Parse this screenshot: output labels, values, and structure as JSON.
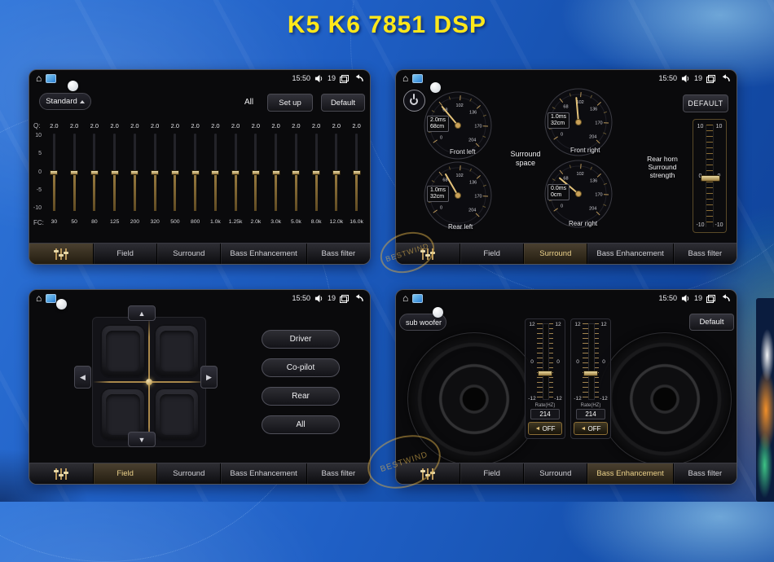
{
  "page": {
    "title": "K5 K6 7851 DSP"
  },
  "statusbar": {
    "time": "15:50",
    "volume_count": "19"
  },
  "tabs": {
    "field": "Field",
    "surround": "Surround",
    "bass_enhancement": "Bass Enhancement",
    "bass_filter": "Bass filter"
  },
  "eq": {
    "preset": "Standard",
    "all_label": "All",
    "setup_label": "Set up",
    "default_label": "Default",
    "q_label": "Q:",
    "fc_label": "FC:",
    "q_values": [
      "2.0",
      "2.0",
      "2.0",
      "2.0",
      "2.0",
      "2.0",
      "2.0",
      "2.0",
      "2.0",
      "2.0",
      "2.0",
      "2.0",
      "2.0",
      "2.0",
      "2.0",
      "2.0"
    ],
    "fc_values": [
      "30",
      "50",
      "80",
      "125",
      "200",
      "320",
      "500",
      "800",
      "1.0k",
      "1.25k",
      "2.0k",
      "3.0k",
      "5.0k",
      "8.0k",
      "12.0k",
      "16.0k"
    ],
    "axis_ticks": [
      "10",
      "5",
      "0",
      "-5",
      "-10"
    ],
    "band_levels_db": [
      0,
      0,
      0,
      0,
      0,
      0,
      0,
      0,
      0,
      0,
      0,
      0,
      0,
      0,
      0,
      0
    ]
  },
  "surround": {
    "default_label": "DEFAULT",
    "center_label": "Surround space",
    "strength_label": "Rear horn Surround strength",
    "strength_ticks": [
      "10",
      "0",
      "-10"
    ],
    "dial_ticks": [
      "0",
      "34",
      "68",
      "102",
      "136",
      "170",
      "204"
    ],
    "gauges": [
      {
        "label": "Front left",
        "ms": "2.0ms",
        "cm": "68cm",
        "needle_deg": 130
      },
      {
        "label": "Front right",
        "ms": "1.0ms",
        "cm": "32cm",
        "needle_deg": 95
      },
      {
        "label": "Rear left",
        "ms": "1.0ms",
        "cm": "32cm",
        "needle_deg": 120
      },
      {
        "label": "Rear right",
        "ms": "0.0ms",
        "cm": "0cm",
        "needle_deg": 140
      }
    ]
  },
  "field": {
    "buttons": [
      "Driver",
      "Co-pilot",
      "Rear",
      "All"
    ]
  },
  "bass": {
    "source_label": "sub woofer",
    "default_label": "Default",
    "scale_ticks": [
      "12",
      "0",
      "-12"
    ],
    "modules": [
      {
        "rate_label": "Rate(HZ)",
        "value": "214",
        "off_label": "OFF"
      },
      {
        "rate_label": "Rate(HZ)",
        "value": "214",
        "off_label": "OFF"
      }
    ]
  },
  "watermark": "BESTWIND"
}
